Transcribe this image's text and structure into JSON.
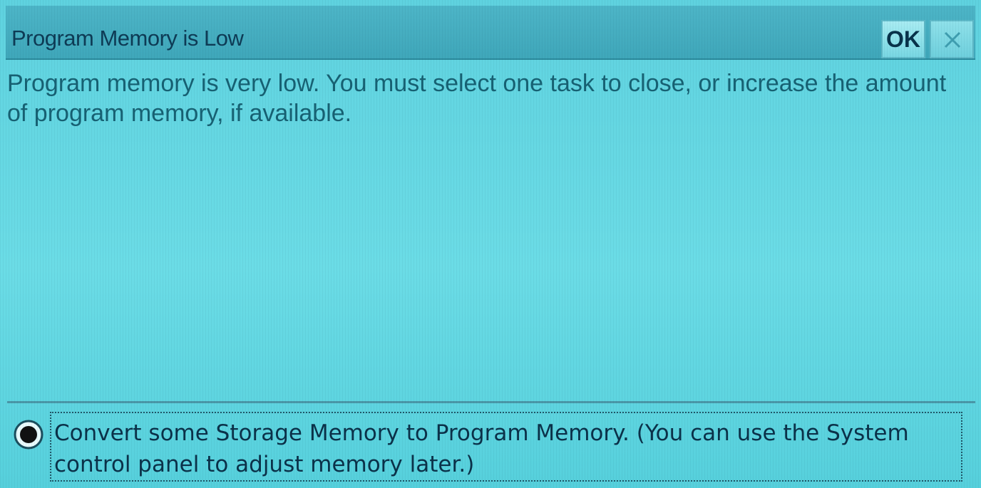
{
  "dialog": {
    "title": "Program Memory is Low",
    "ok_label": "OK",
    "close_icon": "close-icon",
    "message": "Program memory is very low.  You must select one task to close, or increase the amount of program memory, if available.",
    "option": {
      "selected": true,
      "label": "Convert some Storage Memory to Program Memory.  (You can use the System control panel to adjust memory later.)"
    }
  },
  "colors": {
    "background": "#5fd2df",
    "titlebar": "#44adc0",
    "text": "#176173",
    "option_text": "#0b3149"
  }
}
